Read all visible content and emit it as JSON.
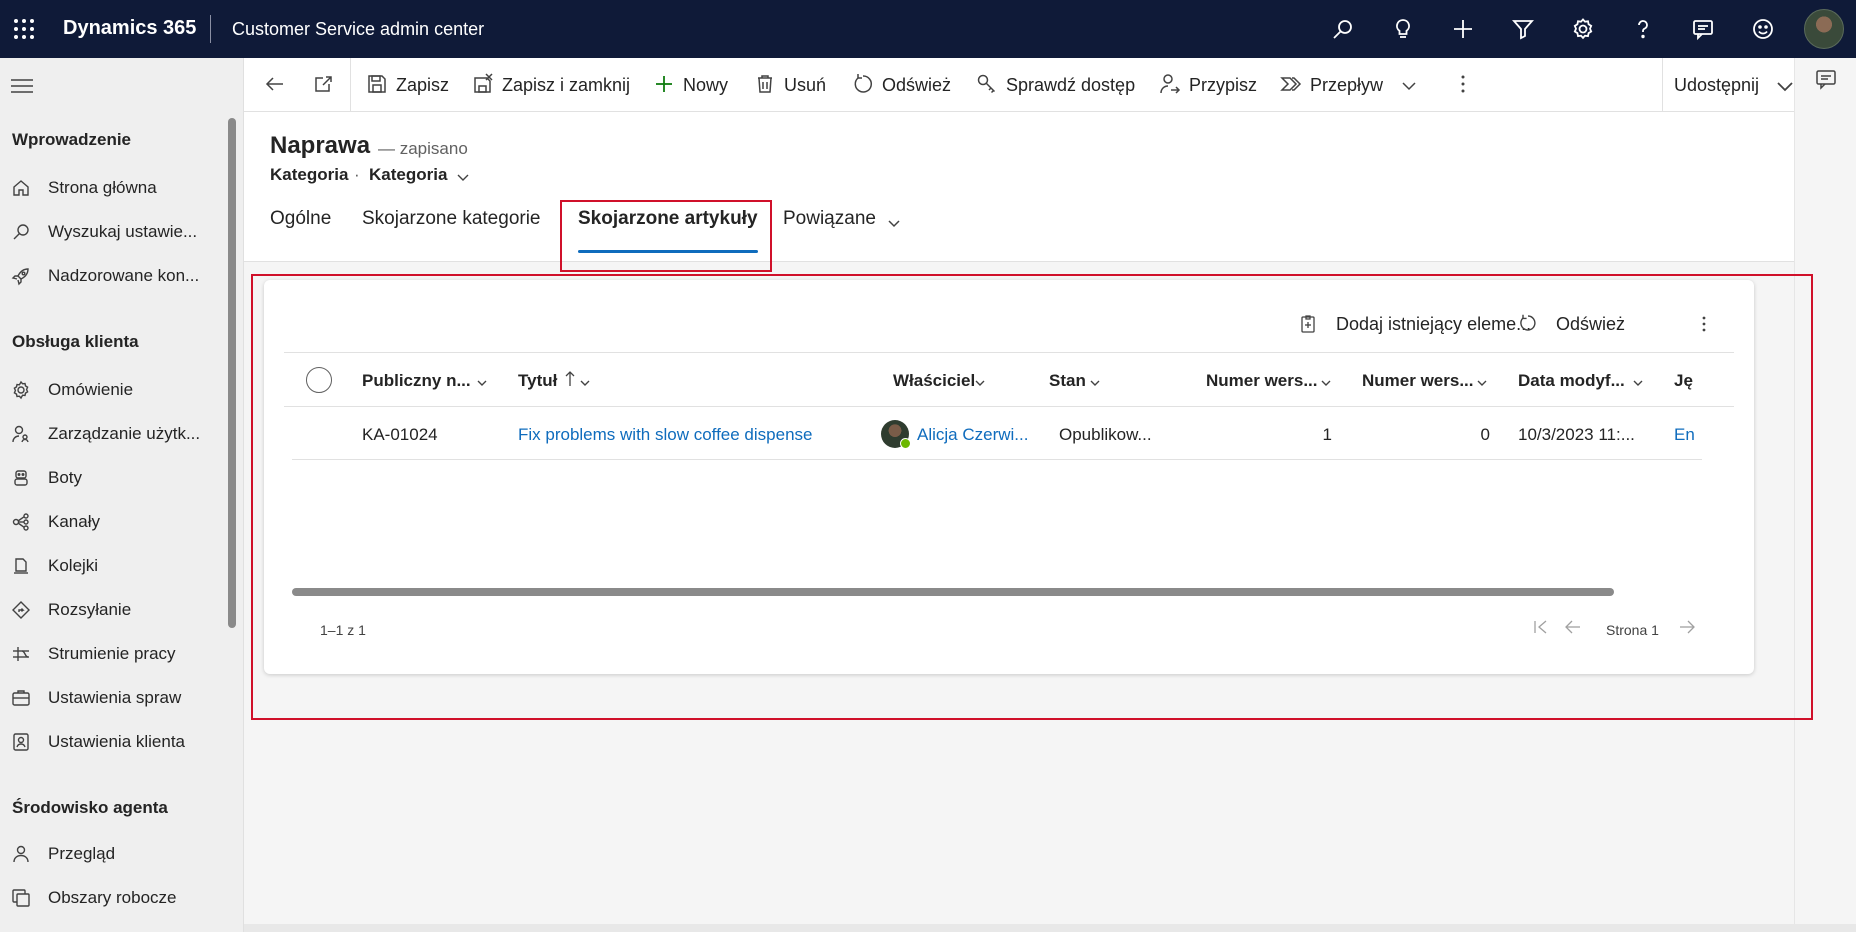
{
  "topbar": {
    "brand": "Dynamics 365",
    "app_name": "Customer Service admin center",
    "icons": [
      "search-icon",
      "lightbulb-icon",
      "plus-icon",
      "filter-icon",
      "settings-icon",
      "help-icon",
      "feedback-icon",
      "smiley-icon",
      "user-avatar"
    ]
  },
  "sidebar": {
    "sections": [
      {
        "title": "Wprowadzenie",
        "items": [
          {
            "label": "Strona główna",
            "icon": "home-icon"
          },
          {
            "label": "Wyszukaj ustawie...",
            "icon": "search-icon"
          },
          {
            "label": "Nadzorowane kon...",
            "icon": "rocket-icon"
          }
        ]
      },
      {
        "title": "Obsługa klienta",
        "items": [
          {
            "label": "Omówienie",
            "icon": "settings-icon"
          },
          {
            "label": "Zarządzanie użytk...",
            "icon": "people-icon"
          },
          {
            "label": "Boty",
            "icon": "bot-icon"
          },
          {
            "label": "Kanały",
            "icon": "channels-icon"
          },
          {
            "label": "Kolejki",
            "icon": "queue-icon"
          },
          {
            "label": "Rozsyłanie",
            "icon": "routing-icon"
          },
          {
            "label": "Strumienie pracy",
            "icon": "workstream-icon"
          },
          {
            "label": "Ustawienia spraw",
            "icon": "case-settings-icon"
          },
          {
            "label": "Ustawienia klienta",
            "icon": "customer-settings-icon"
          }
        ]
      },
      {
        "title": "Środowisko agenta",
        "items": [
          {
            "label": "Przegląd",
            "icon": "person-icon"
          },
          {
            "label": "Obszary robocze",
            "icon": "workspaces-icon"
          }
        ]
      }
    ]
  },
  "commandbar": {
    "save": "Zapisz",
    "save_close": "Zapisz i zamknij",
    "new": "Nowy",
    "delete": "Usuń",
    "refresh": "Odśwież",
    "check_access": "Sprawdź dostęp",
    "assign": "Przypisz",
    "flow": "Przepływ",
    "share": "Udostępnij"
  },
  "record": {
    "title": "Naprawa",
    "saved_status": "— zapisano",
    "entity": "Kategoria",
    "separator": "·",
    "form_name": "Kategoria"
  },
  "tabs": {
    "general": "Ogólne",
    "related_categories": "Skojarzone kategorie",
    "related_articles": "Skojarzone artykuły",
    "related": "Powiązane",
    "active": "Skojarzone artykuły"
  },
  "grid": {
    "commands": {
      "add_existing": "Dodaj istniejący eleme...",
      "refresh": "Odśwież"
    },
    "columns": [
      "Publiczny n...",
      "Tytuł",
      "Właściciel",
      "Stan",
      "Numer wers...",
      "Numer wers...",
      "Data modyf...",
      "Ję"
    ],
    "sorted_column": "Tytuł",
    "rows": [
      {
        "public_number": "KA-01024",
        "title": "Fix problems with slow coffee dispense",
        "owner": "Alicja Czerwi...",
        "state": "Opublikow...",
        "major_version": "1",
        "minor_version": "0",
        "modified": "10/3/2023 11:...",
        "language": "En"
      }
    ],
    "footer": {
      "count": "1–1 z 1",
      "page": "Strona 1"
    }
  },
  "colors": {
    "topbar": "#0f1a38",
    "accent": "#0f6cbd",
    "highlight": "#d0102a",
    "presence": "#6bb700"
  }
}
